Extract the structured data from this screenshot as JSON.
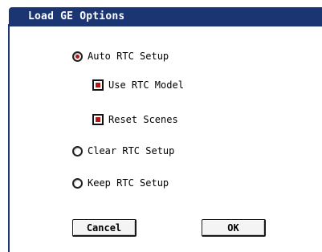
{
  "dialog": {
    "title": "Load GE Options",
    "options": {
      "auto_rtc": {
        "label": "Auto RTC Setup",
        "selected": true
      },
      "use_rtc_model": {
        "label": "Use RTC Model",
        "checked": true
      },
      "reset_scenes": {
        "label": "Reset Scenes",
        "checked": true
      },
      "clear_rtc": {
        "label": "Clear RTC Setup",
        "selected": false
      },
      "keep_rtc": {
        "label": "Keep RTC Setup",
        "selected": false
      }
    },
    "buttons": {
      "cancel": "Cancel",
      "ok": "OK"
    },
    "colors": {
      "title_bar": "#1a3572",
      "indicator": "#b01818"
    }
  }
}
